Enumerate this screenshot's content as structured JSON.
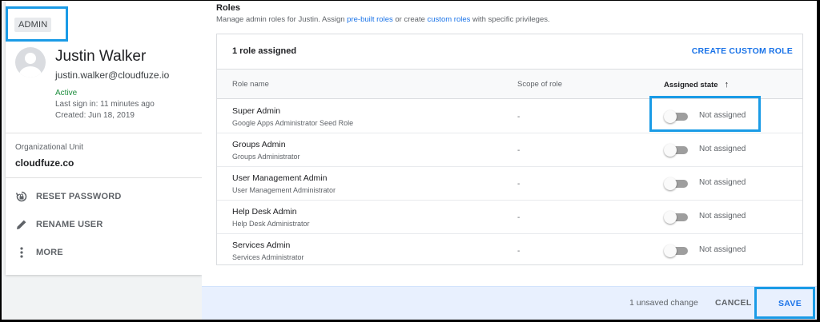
{
  "user": {
    "badge": "ADMIN",
    "name": "Justin Walker",
    "email": "justin.walker@cloudfuze.io",
    "status": "Active",
    "last_sign_in": "Last sign in: 11 minutes ago",
    "created": "Created: Jun 18, 2019",
    "org_label": "Organizational Unit",
    "org_value": "cloudfuze.co",
    "actions": [
      {
        "label": "RESET PASSWORD",
        "icon": "lock-reset-icon"
      },
      {
        "label": "RENAME USER",
        "icon": "pencil-icon"
      },
      {
        "label": "MORE",
        "icon": "more-vertical-icon"
      }
    ]
  },
  "roles": {
    "title": "Roles",
    "subtitle_pre": "Manage admin roles for Justin. Assign ",
    "subtitle_link1": "pre-built roles",
    "subtitle_mid": " or create ",
    "subtitle_link2": "custom roles",
    "subtitle_post": " with specific privileges.",
    "count_label": "1 role assigned",
    "create_button": "CREATE CUSTOM ROLE",
    "columns": {
      "name": "Role name",
      "scope": "Scope of role",
      "state": "Assigned state"
    },
    "rows": [
      {
        "name": "Super Admin",
        "desc": "Google Apps Administrator Seed Role",
        "scope": "-",
        "state": "Not assigned",
        "toggled": false
      },
      {
        "name": "Groups Admin",
        "desc": "Groups Administrator",
        "scope": "-",
        "state": "Not assigned",
        "toggled": false
      },
      {
        "name": "User Management Admin",
        "desc": "User Management Administrator",
        "scope": "-",
        "state": "Not assigned",
        "toggled": false
      },
      {
        "name": "Help Desk Admin",
        "desc": "Help Desk Administrator",
        "scope": "-",
        "state": "Not assigned",
        "toggled": false
      },
      {
        "name": "Services Admin",
        "desc": "Services Administrator",
        "scope": "-",
        "state": "Not assigned",
        "toggled": false
      }
    ]
  },
  "footer": {
    "unsaved": "1 unsaved change",
    "cancel": "CANCEL",
    "save": "SAVE"
  },
  "colors": {
    "accent": "#1a73e8",
    "highlight": "#1a9be6",
    "active_green": "#1e8e3e"
  }
}
